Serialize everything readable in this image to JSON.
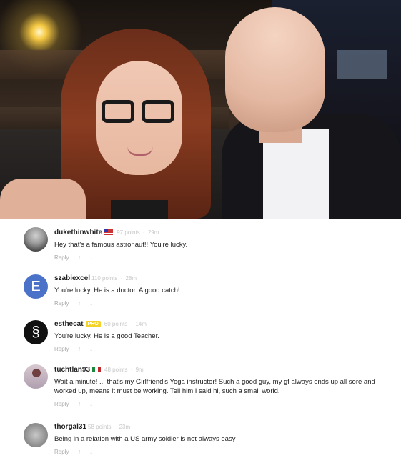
{
  "comments": [
    {
      "username": "dukethinwhite",
      "points": "97 points",
      "time": "29m",
      "text": "Hey that's a famous astronaut!! You're lucky.",
      "reply": "Reply",
      "avatar": "profile-photo",
      "flag": "us"
    },
    {
      "username": "szabiexcel",
      "points": "110 points",
      "time": "28m",
      "text": "You're lucky. He is a doctor. A good catch!",
      "reply": "Reply",
      "avatar_letter": "E",
      "avatar_color": "#4b72c9"
    },
    {
      "username": "esthecat",
      "badge": "PRO",
      "points": "60 points",
      "time": "14m",
      "text": "You're lucky. He is a good Teacher.",
      "reply": "Reply",
      "avatar_glyph": "§"
    },
    {
      "username": "tuchtlan93",
      "points": "48 points",
      "time": "9m",
      "text": "Wait a minute! ... that's my Girlfriend's Yoga instructor! Such a good guy, my gf always ends up all sore and worked up, means it must be working. Tell him I said hi, such a small world.",
      "reply": "Reply",
      "avatar": "profile-photo",
      "flag": "mx"
    },
    {
      "username": "thorgal31",
      "points": "58 points",
      "time": "23m",
      "text": "Being in a relation with a US army soldier is not always easy",
      "reply": "Reply",
      "avatar": "profile-photo"
    }
  ],
  "icons": {
    "upvote": "up-arrow-icon",
    "downvote": "down-arrow-icon"
  },
  "colors": {
    "badge": "#f3d22a",
    "meta_gray": "#c8c8c8",
    "reply_gray": "#aaaaaa"
  }
}
